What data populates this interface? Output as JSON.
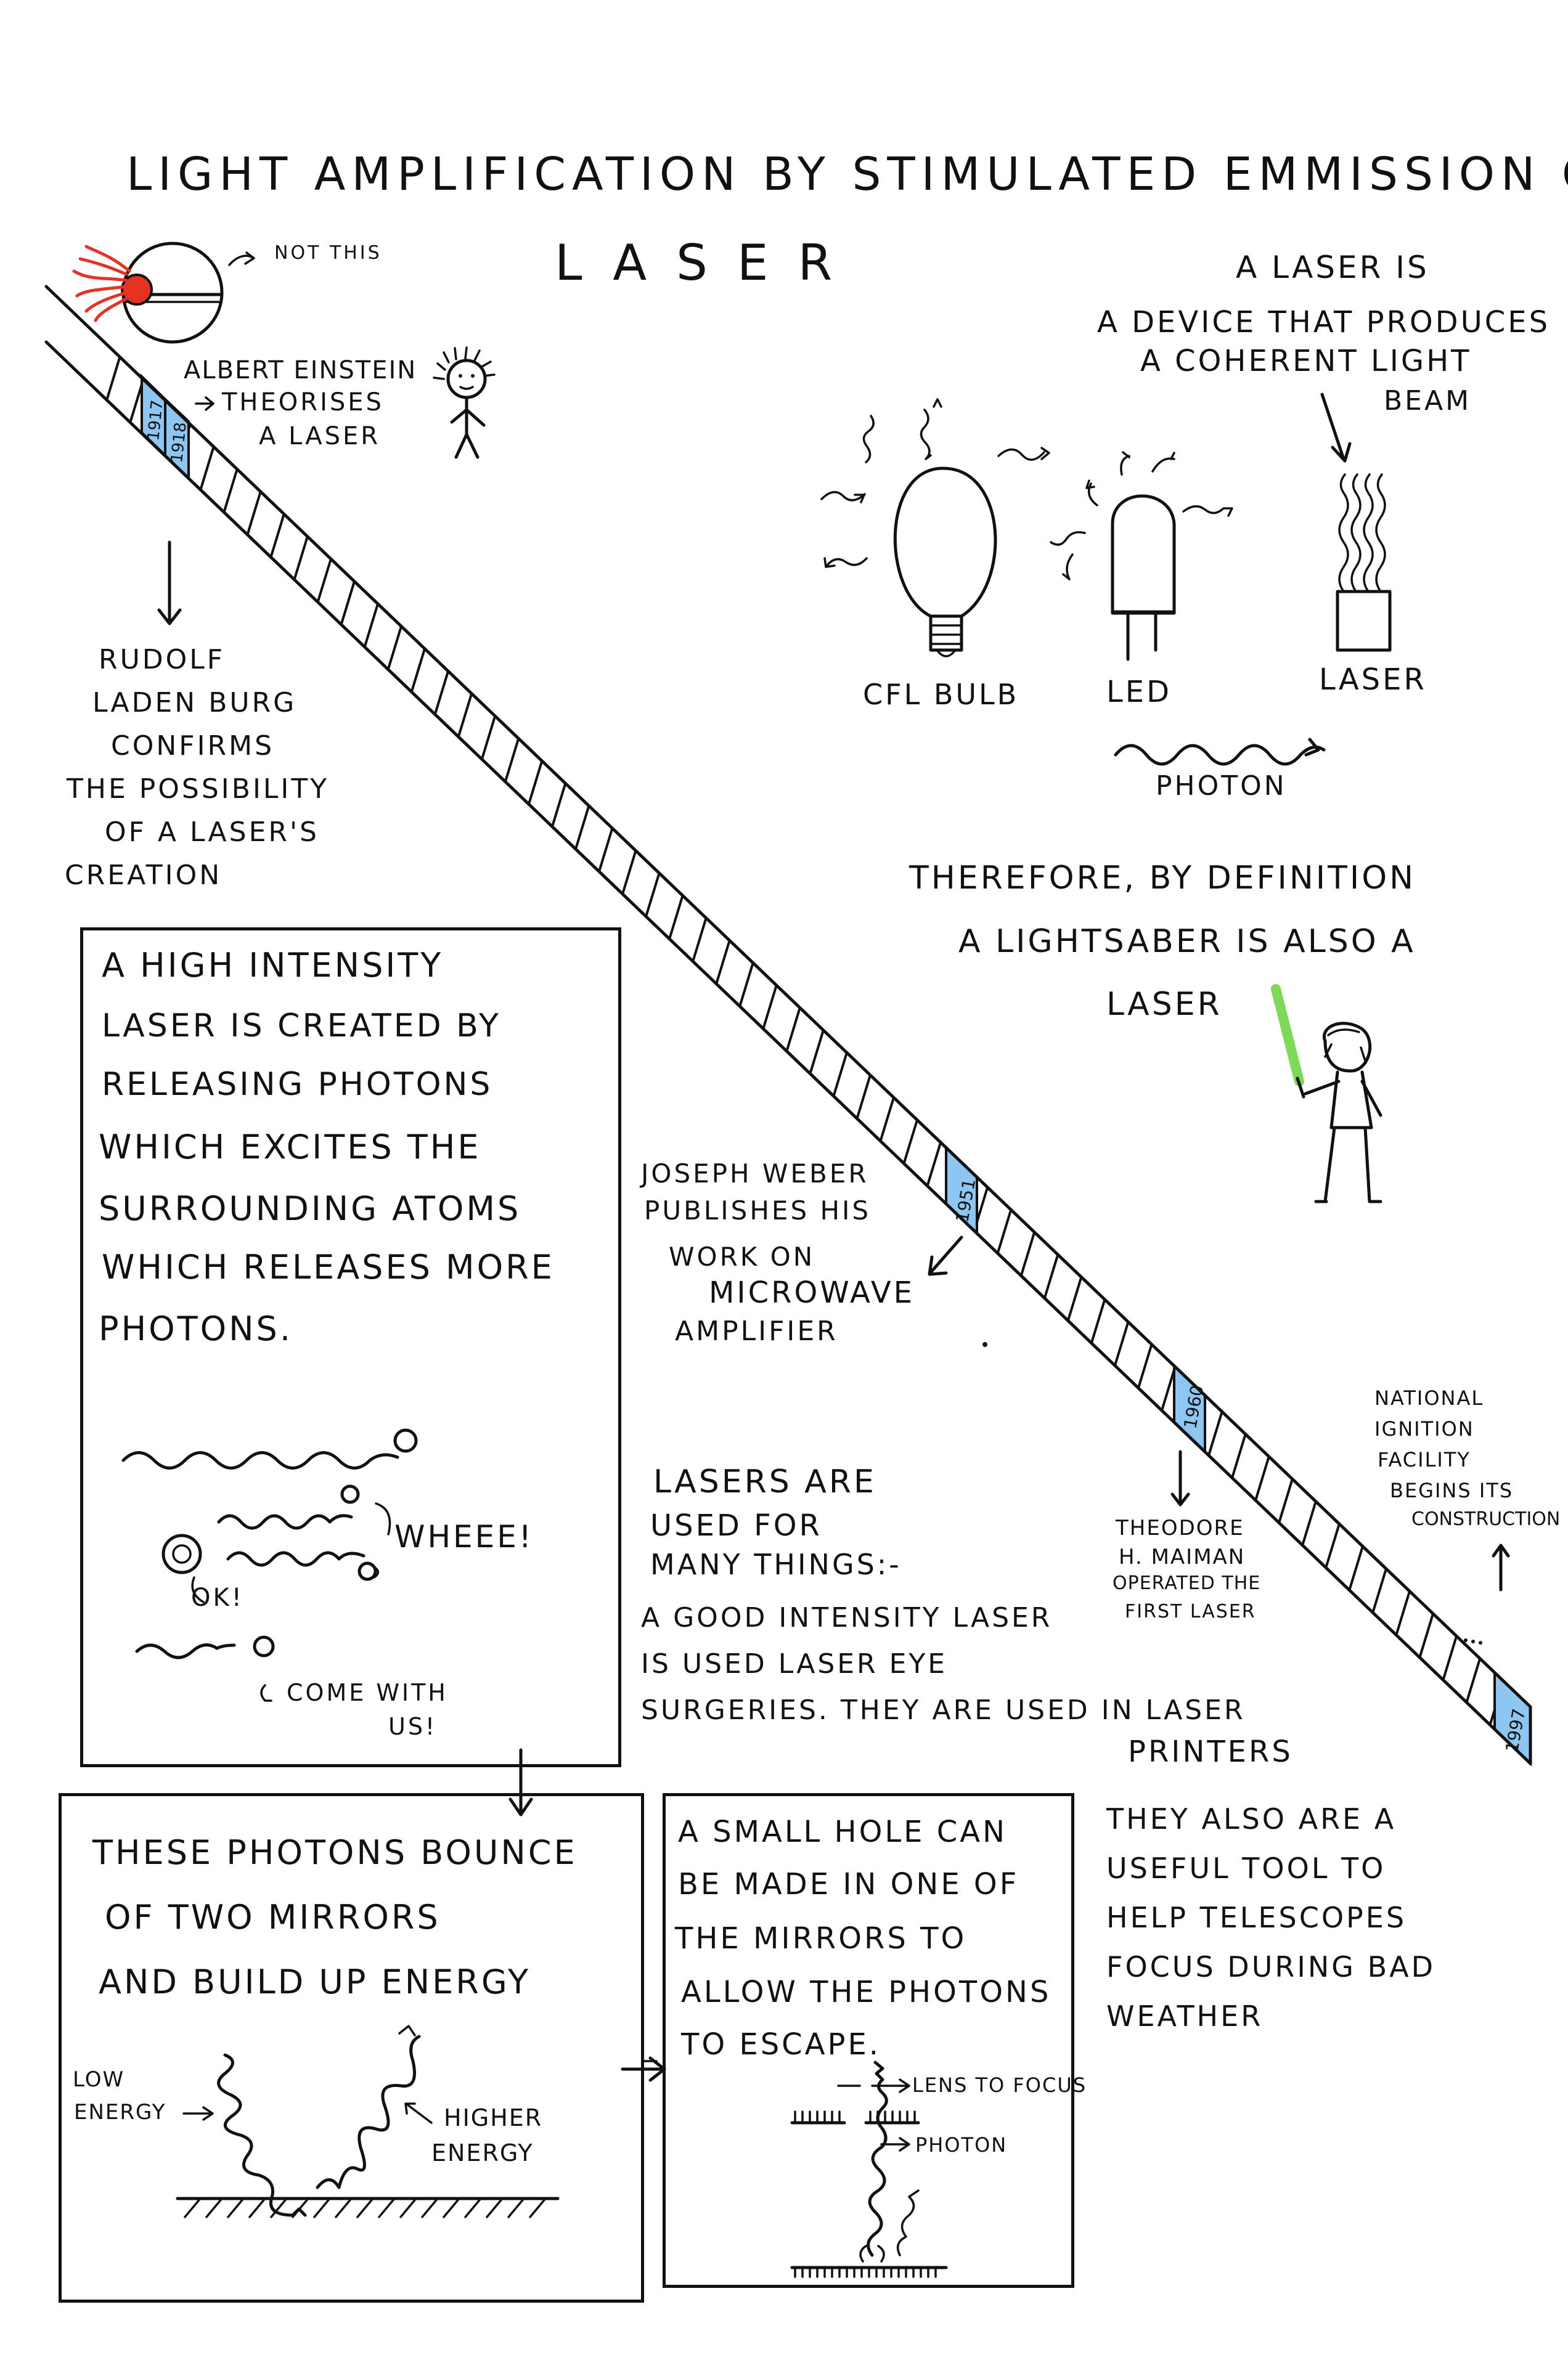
{
  "title": "LIGHT AMPLIFICATION BY STIMULATED EMMISSION OF RADIATION",
  "acronym": "LASER",
  "not_this": "NOT THIS",
  "definition": {
    "heading": "A LASER IS",
    "line1": "A DEVICE THAT PRODUCES",
    "line2": "A COHERENT LIGHT",
    "line3": "BEAM"
  },
  "light_sources": [
    "CFL BULB",
    "LED",
    "LASER"
  ],
  "photon_label": "PHOTON",
  "lightsaber": {
    "line1": "THEREFORE, BY DEFINITION",
    "line2": "A LIGHTSABER IS ALSO A",
    "line3": "LASER"
  },
  "timeline": [
    {
      "year": "1917",
      "event": [
        "ALBERT EINSTEIN",
        "THEORISES",
        "A LASER"
      ]
    },
    {
      "year": "1918",
      "event": [
        "RUDOLF",
        "LADEN BURG",
        "CONFIRMS",
        "THE POSSIBILITY",
        "OF A LASER'S",
        "CREATION"
      ]
    },
    {
      "year": "1951",
      "event": [
        "JOSEPH WEBER",
        "PUBLISHES HIS",
        "WORK ON",
        "MICROWAVE",
        "AMPLIFIER"
      ]
    },
    {
      "year": "1960",
      "event": [
        "THEODORE",
        "H. MAIMAN",
        "OPERATED THE",
        "FIRST LASER"
      ]
    },
    {
      "year": "1997",
      "event": [
        "NATIONAL",
        "IGNITION",
        "FACILITY",
        "BEGINS ITS",
        "CONSTRUCTION"
      ]
    }
  ],
  "panel1": [
    "A HIGH INTENSITY",
    "LASER IS CREATED BY",
    "RELEASING PHOTONS",
    "WHICH EXCITES THE",
    "SURROUNDING ATOMS",
    "WHICH RELEASES MORE",
    "PHOTONS."
  ],
  "speech": {
    "wheee": "WHEEE!",
    "ok": "OK!",
    "come1": "COME WITH",
    "come2": "US!"
  },
  "panel2": [
    "THESE PHOTONS BOUNCE",
    "OF TWO MIRRORS",
    "AND BUILD UP ENERGY"
  ],
  "energy": {
    "low1": "LOW",
    "low2": "ENERGY",
    "high1": "HIGHER",
    "high2": "ENERGY"
  },
  "panel3": [
    "A SMALL HOLE CAN",
    "BE MADE IN ONE OF",
    "THE MIRRORS TO",
    "ALLOW THE PHOTONS",
    "TO ESCAPE."
  ],
  "lens_label": "LENS TO FOCUS",
  "photon_label2": "PHOTON",
  "uses": [
    "LASERS ARE",
    "USED FOR",
    "MANY THINGS:-",
    "A GOOD INTENSITY LASER",
    "IS USED LASER EYE",
    "SURGERIES. THEY ARE USED IN LASER",
    "PRINTERS"
  ],
  "telescopes": [
    "THEY ALSO ARE A",
    "USEFUL TOOL TO",
    "HELP TELESCOPES",
    "FOCUS DURING BAD",
    "WEATHER"
  ],
  "colors": {
    "ink": "#111111",
    "highlight": "#8ec6f2",
    "saber": "#7ed957",
    "flame": "#e53222"
  }
}
